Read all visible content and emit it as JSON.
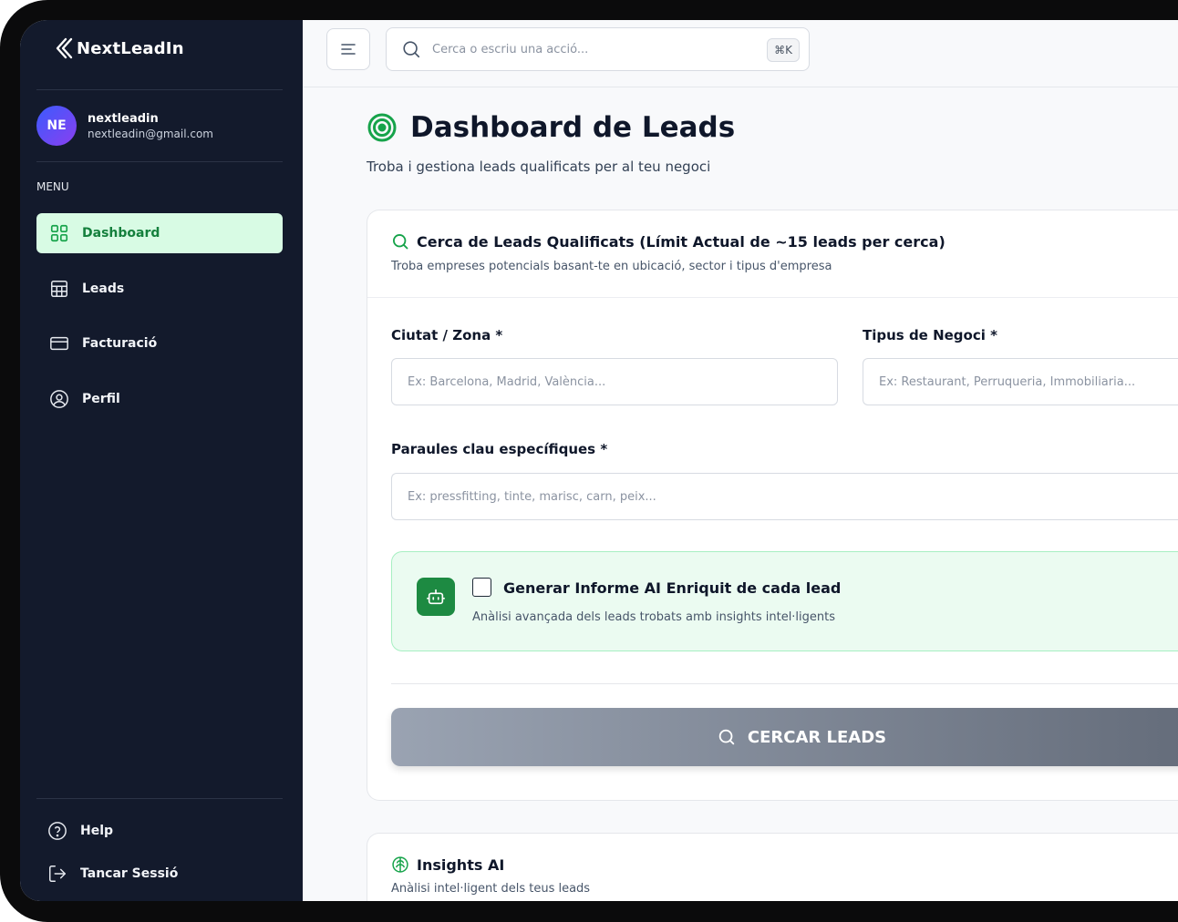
{
  "app": {
    "name": "NextLeadIn"
  },
  "user": {
    "initials": "NE",
    "name": "nextleadin",
    "email": "nextleadin@gmail.com"
  },
  "sidebar": {
    "menu_label": "MENU",
    "items": [
      {
        "label": "Dashboard",
        "icon": "dashboard-grid-icon",
        "active": true
      },
      {
        "label": "Leads",
        "icon": "table-icon"
      },
      {
        "label": "Facturació",
        "icon": "credit-card-icon"
      },
      {
        "label": "Perfil",
        "icon": "user-circle-icon"
      }
    ],
    "bottom": [
      {
        "label": "Help",
        "icon": "help-circle-icon"
      },
      {
        "label": "Tancar Sessió",
        "icon": "logout-icon"
      }
    ]
  },
  "topbar": {
    "search_placeholder": "Cerca o escriu una acció...",
    "shortcut": "⌘K"
  },
  "page": {
    "title": "Dashboard de Leads",
    "subtitle": "Troba i gestiona leads qualificats per al teu negoci"
  },
  "search_card": {
    "title": "Cerca de Leads Qualificats (Límit Actual de ~15 leads per cerca)",
    "subtitle": "Troba empreses potencials basant-te en ubicació, sector i tipus d'empresa",
    "city_label": "Ciutat / Zona *",
    "city_placeholder": "Ex: Barcelona, Madrid, València...",
    "business_label": "Tipus de Negoci *",
    "business_placeholder": "Ex: Restaurant, Perruqueria, Immobiliaria...",
    "keywords_label": "Paraules clau específiques *",
    "keywords_placeholder": "Ex: pressfitting, tinte, marisc, carn, peix...",
    "ai_option": {
      "title": "Generar Informe AI Enriquit de cada lead",
      "subtitle": "Anàlisi avançada dels leads trobats amb insights intel·ligents",
      "checked": false
    },
    "button_label": "CERCAR LEADS"
  },
  "insights_card": {
    "title": "Insights AI",
    "subtitle": "Anàlisi intel·ligent dels teus leads"
  },
  "colors": {
    "sidebar": "#131a2c",
    "accent": "#16a34a",
    "active_bg": "#d8fbe4"
  }
}
